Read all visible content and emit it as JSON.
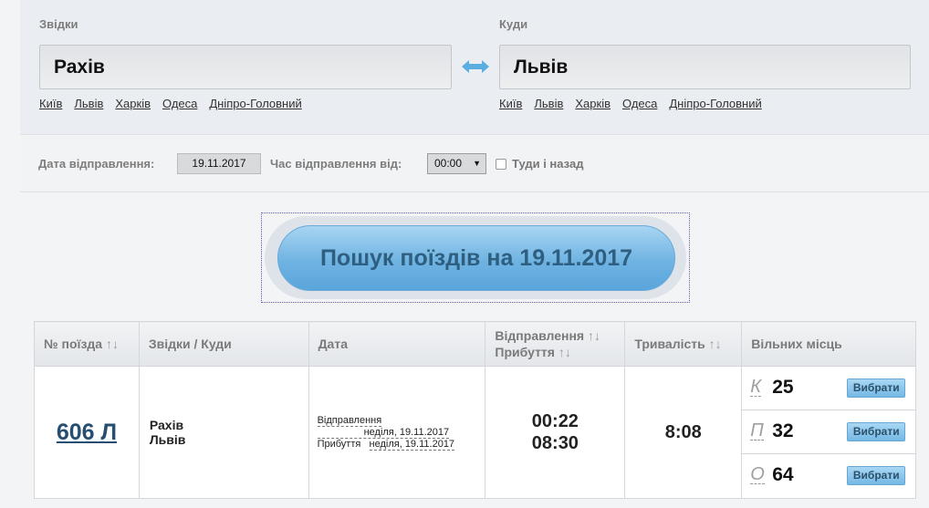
{
  "from": {
    "label": "Звідки",
    "value": "Рахів",
    "quick": [
      "Київ",
      "Львів",
      "Харків",
      "Одеса",
      "Дніпро-Головний"
    ]
  },
  "to": {
    "label": "Куди",
    "value": "Львів",
    "quick": [
      "Київ",
      "Львів",
      "Харків",
      "Одеса",
      "Дніпро-Головний"
    ]
  },
  "date": {
    "label": "Дата відправлення:",
    "value": "19.11.2017"
  },
  "time": {
    "label": "Час відправлення від:",
    "value": "00:00"
  },
  "round_trip": {
    "label": "Туди і назад",
    "checked": false
  },
  "search_button": "Пошук поїздів на 19.11.2017",
  "table": {
    "headers": {
      "train_no": "№ поїзда",
      "route": "Звідки / Куди",
      "date": "Дата",
      "departure": "Відправлення",
      "arrival": "Прибуття",
      "duration": "Тривалість",
      "seats": "Вільних місць"
    },
    "sort_icon": "↑↓",
    "rows": [
      {
        "train_no": "606 Л",
        "from": "Рахів",
        "to": "Львів",
        "dep_label": "Відправлення",
        "dep_date": "неділя, 19.11.2017",
        "arr_label": "Прибуття",
        "arr_date": "неділя, 19.11.2017",
        "dep_time": "00:22",
        "arr_time": "08:30",
        "duration": "8:08",
        "seats": [
          {
            "class": "К",
            "count": "25",
            "button": "Вибрати"
          },
          {
            "class": "П",
            "count": "32",
            "button": "Вибрати"
          },
          {
            "class": "О",
            "count": "64",
            "button": "Вибрати"
          }
        ]
      }
    ]
  },
  "colors": {
    "accent": "#6fb3e2",
    "link": "#264e70"
  },
  "icons": {
    "swap": "swap-arrows-icon",
    "dropdown": "chevron-down-icon",
    "sort": "sort-icon"
  }
}
